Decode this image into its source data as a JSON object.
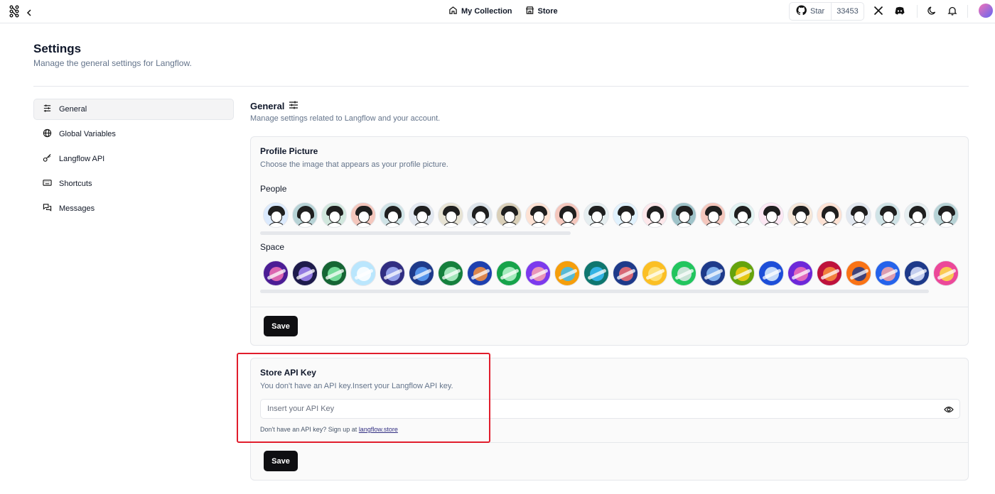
{
  "topbar": {
    "nav": [
      {
        "label": "My Collection",
        "icon": "home-icon"
      },
      {
        "label": "Store",
        "icon": "store-icon"
      }
    ],
    "github": {
      "star_label": "Star",
      "count": "33453"
    }
  },
  "page": {
    "title": "Settings",
    "subtitle": "Manage the general settings for Langflow."
  },
  "sidebar": {
    "items": [
      {
        "label": "General",
        "icon": "sliders-icon",
        "active": true
      },
      {
        "label": "Global Variables",
        "icon": "globe-icon"
      },
      {
        "label": "Langflow API",
        "icon": "key-icon"
      },
      {
        "label": "Shortcuts",
        "icon": "keyboard-icon"
      },
      {
        "label": "Messages",
        "icon": "messages-icon"
      }
    ]
  },
  "general": {
    "title": "General",
    "subtitle": "Manage settings related to Langflow and your account."
  },
  "profile_picture": {
    "title": "Profile Picture",
    "description": "Choose the image that appears as your profile picture.",
    "people_label": "People",
    "space_label": "Space",
    "save_label": "Save",
    "people_colors": [
      "#dbeafe",
      "#b7d3d6",
      "#d1e7dd",
      "#f4c7bd",
      "#cfe3e6",
      "#e2e8f0",
      "#e7e3d4",
      "#dde4ea",
      "#d9cfb8",
      "#fde2d4",
      "#f4c7bd",
      "#e5eef0",
      "#e0f2fe",
      "#fde7ea",
      "#9fc3c9",
      "#f4c7bd",
      "#e0f2f1",
      "#fce7f3",
      "#f5e6d8",
      "#fde2d4",
      "#e2e8f0",
      "#cfe3e6",
      "#e5eef0",
      "#b7d3d6"
    ],
    "space_colors": [
      "#4c1d95",
      "#1e1b4b",
      "#166534",
      "#bae6fd",
      "#312e81",
      "#1e3a8a",
      "#15803d",
      "#1e40af",
      "#16a34a",
      "#7c3aed",
      "#f59e0b",
      "#0f766e",
      "#1e3a8a",
      "#fbbf24",
      "#22c55e",
      "#1e3a8a",
      "#65a30d",
      "#1d4ed8",
      "#6d28d9",
      "#be123c",
      "#f97316",
      "#2563eb",
      "#1e3a8a",
      "#ec4899"
    ],
    "space_accents": [
      "#f472b6",
      "#a78bfa",
      "#86efac",
      "#ffffff",
      "#a5b4fc",
      "#60a5fa",
      "#bbf7d0",
      "#fb923c",
      "#bbf7d0",
      "#fda4af",
      "#38bdf8",
      "#38bdf8",
      "#f87171",
      "#fde68a",
      "#e5e7eb",
      "#93c5fd",
      "#facc15",
      "#e0f2fe",
      "#f472b6",
      "#fb923c",
      "#1e3a8a",
      "#fca5a5",
      "#e0e7ff",
      "#fde047"
    ]
  },
  "store_api": {
    "title": "Store API Key",
    "description": "You don't have an API key.Insert your Langflow API key.",
    "placeholder": "Insert your API Key",
    "hint_prefix": "Don't have an API key? Sign up at ",
    "hint_link": "langflow.store",
    "save_label": "Save"
  }
}
